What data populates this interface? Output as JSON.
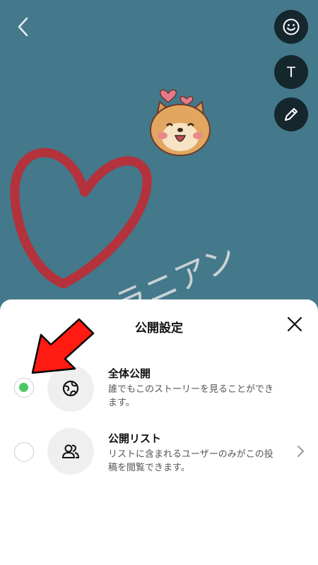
{
  "colors": {
    "canvas_bg": "#44788b",
    "tool_bg": "#15262d",
    "selected_radio": "#4cc764",
    "annotation_arrow": "#ff1a12",
    "heart_drawing": "#b3323c"
  },
  "canvas": {
    "handwritten_text": "ラニアン"
  },
  "toolbar": {
    "back_icon": "chevron-left-icon",
    "tools": [
      "smiley-icon",
      "text-tool-icon",
      "pencil-icon"
    ],
    "text_tool_glyph": "T"
  },
  "sheet": {
    "title": "公開設定",
    "close_icon": "close-icon",
    "options": [
      {
        "title": "全体公開",
        "description": "誰でもこのストーリーを見ることができます。",
        "icon": "globe-icon",
        "selected": true
      },
      {
        "title": "公開リスト",
        "description": "リストに含まれるユーザーのみがこの投稿を閲覧できます。",
        "icon": "people-icon",
        "selected": false,
        "has_chevron": true
      }
    ]
  }
}
